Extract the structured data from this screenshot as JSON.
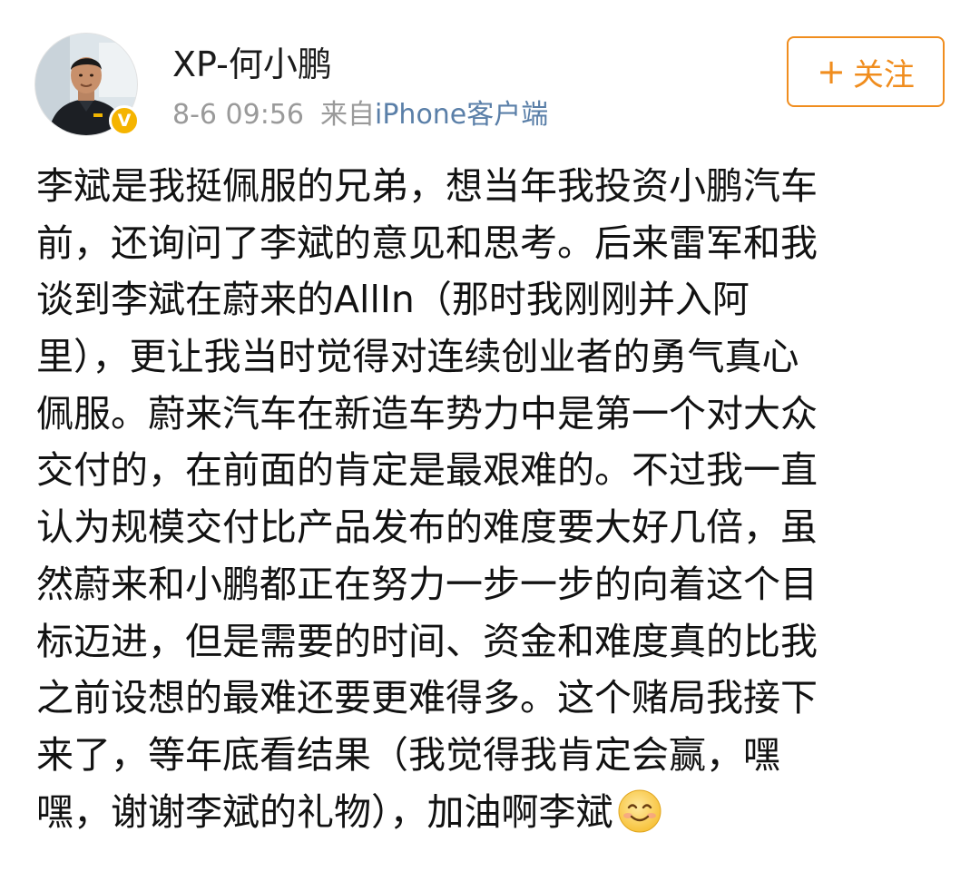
{
  "post": {
    "author": {
      "name": "XP-何小鹏",
      "verified_badge": "V",
      "avatar_icon": "person-avatar"
    },
    "meta": {
      "time": "8-6 09:56",
      "source_prefix": "来自",
      "source_client": "iPhone客户端"
    },
    "follow_button": {
      "plus": "+",
      "label": "关注"
    },
    "content_lines": [
      "李斌是我挺佩服的兄弟，想当年我投资小鹏汽车",
      "前，还询问了李斌的意见和思考。后来雷军和我",
      "谈到李斌在蔚来的AllIn（那时我刚刚并入阿",
      "里），更让我当时觉得对连续创业者的勇气真心",
      "佩服。蔚来汽车在新造车势力中是第一个对大众",
      "交付的，在前面的肯定是最艰难的。不过我一直",
      "认为规模交付比产品发布的难度要大好几倍，虽",
      "然蔚来和小鹏都正在努力一步一步的向着这个目",
      "标迈进，但是需要的时间、资金和难度真的比我",
      "之前设想的最难还要更难得多。这个赌局我接下",
      "来了，等年底看结果（我觉得我肯定会赢，嘿",
      "嘿，谢谢李斌的礼物），加油啊李斌"
    ],
    "emoji_icon": "smile-emoji"
  },
  "colors": {
    "accent_orange": "#f08d1e",
    "link_blue": "#5a7fa8",
    "meta_gray": "#9a9a9a",
    "verified_gold": "#f5b400"
  }
}
